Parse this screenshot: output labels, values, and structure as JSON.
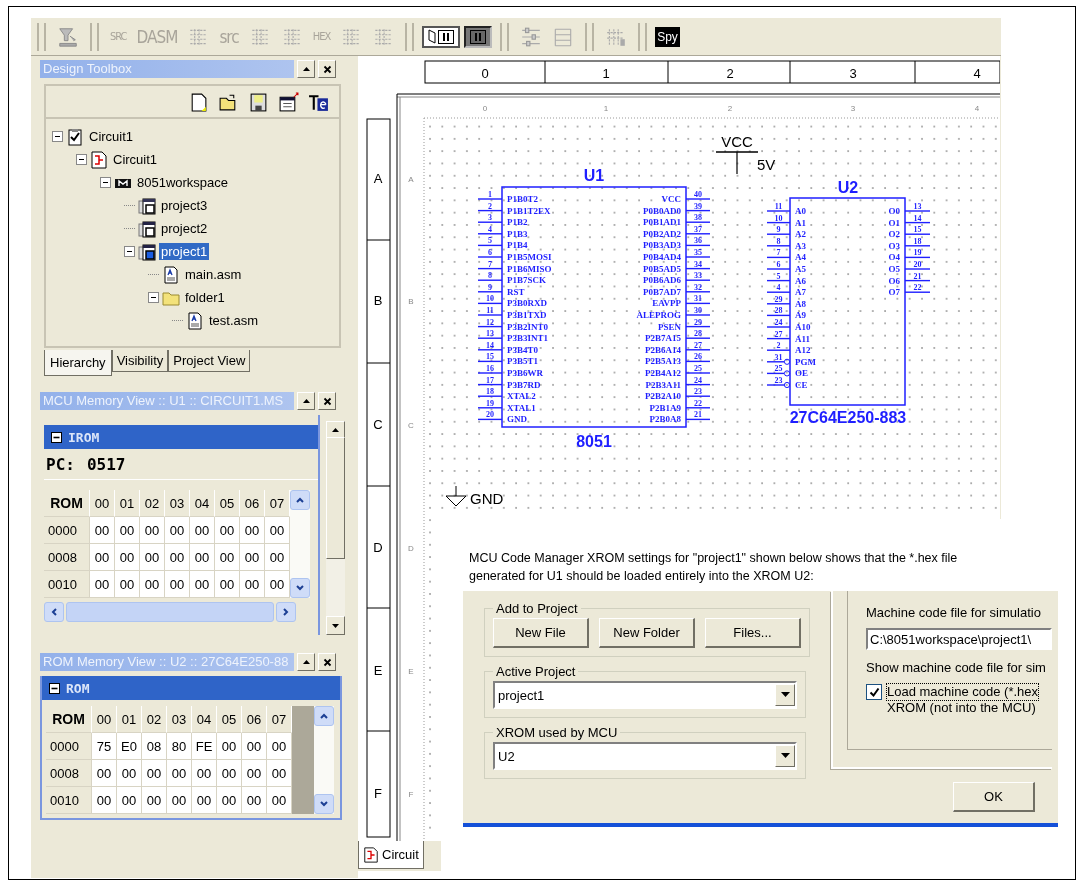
{
  "toolbar": {
    "groups": [
      [
        {
          "kind": "funnel"
        }
      ],
      [
        {
          "kind": "label",
          "text": "SRC"
        },
        {
          "kind": "label",
          "text": "DASM"
        },
        {
          "kind": "grid"
        },
        {
          "kind": "label",
          "text": "src"
        },
        {
          "kind": "grid"
        },
        {
          "kind": "grid"
        },
        {
          "kind": "label",
          "text": "HEX"
        },
        {
          "kind": "grid"
        },
        {
          "kind": "grid"
        }
      ],
      [
        {
          "kind": "page-pause"
        },
        {
          "kind": "pause"
        }
      ],
      [
        {
          "kind": "sliders"
        },
        {
          "kind": "lines"
        }
      ],
      [
        {
          "kind": "pins"
        }
      ],
      [
        {
          "kind": "badge",
          "text": "Spy"
        }
      ]
    ]
  },
  "design_toolbox": {
    "title": "Design Toolbox",
    "tree": [
      {
        "label": "Circuit1",
        "kind": "check",
        "expanded": true,
        "selected": false,
        "children": [
          {
            "label": "Circuit1",
            "kind": "schematic",
            "expanded": true,
            "selected": false,
            "children": [
              {
                "label": "8051workspace",
                "kind": "chip",
                "expanded": true,
                "selected": false,
                "children": [
                  {
                    "label": "project3",
                    "kind": "hex-project",
                    "selected": false
                  },
                  {
                    "label": "project2",
                    "kind": "project",
                    "selected": false
                  },
                  {
                    "label": "project1",
                    "kind": "active-project",
                    "expanded": true,
                    "selected": true,
                    "children": [
                      {
                        "label": "main.asm",
                        "kind": "asm",
                        "selected": false
                      },
                      {
                        "label": "folder1",
                        "kind": "folder",
                        "expanded": true,
                        "selected": false,
                        "children": [
                          {
                            "label": "test.asm",
                            "kind": "asm",
                            "selected": false
                          }
                        ]
                      }
                    ]
                  }
                ]
              }
            ]
          }
        ]
      }
    ],
    "tabs": [
      {
        "label": "Hierarchy",
        "selected": true
      },
      {
        "label": "Visibility",
        "selected": false
      },
      {
        "label": "Project View",
        "selected": false
      }
    ]
  },
  "mcu_memory": {
    "title": "MCU Memory View :: U1 :: CIRCUIT1.MS",
    "section": "IROM",
    "pc_label": "PC:",
    "pc_value": "0517",
    "columns": [
      "ROM",
      "00",
      "01",
      "02",
      "03",
      "04",
      "05",
      "06",
      "07"
    ],
    "rows": [
      [
        "0000",
        "00",
        "00",
        "00",
        "00",
        "00",
        "00",
        "00",
        "00"
      ],
      [
        "0008",
        "00",
        "00",
        "00",
        "00",
        "00",
        "00",
        "00",
        "00"
      ],
      [
        "0010",
        "00",
        "00",
        "00",
        "00",
        "00",
        "00",
        "00",
        "00"
      ]
    ]
  },
  "rom_memory": {
    "title": "ROM Memory View :: U2 :: 27C64E250-88",
    "section": "ROM",
    "columns": [
      "ROM",
      "00",
      "01",
      "02",
      "03",
      "04",
      "05",
      "06",
      "07"
    ],
    "rows": [
      [
        "0000",
        "75",
        "E0",
        "08",
        "80",
        "FE",
        "00",
        "00",
        "00"
      ],
      [
        "0008",
        "00",
        "00",
        "00",
        "00",
        "00",
        "00",
        "00",
        "00"
      ],
      [
        "0010",
        "00",
        "00",
        "00",
        "00",
        "00",
        "00",
        "00",
        "00"
      ]
    ]
  },
  "schematic": {
    "ruler_columns": [
      "0",
      "1",
      "2",
      "3",
      "4"
    ],
    "ruler_rows": [
      "A",
      "B",
      "C",
      "D",
      "E",
      "F"
    ],
    "inner_columns": [
      "0",
      "1",
      "2",
      "3",
      "4"
    ],
    "inner_rows": [
      "A",
      "B",
      "C",
      "D",
      "E",
      "F"
    ],
    "power": {
      "net": "VCC",
      "voltage": "5V"
    },
    "ground": {
      "net": "GND"
    },
    "u1": {
      "ref": "U1",
      "type": "8051",
      "left_pins": [
        {
          "num": "1",
          "name": "P1B0T2"
        },
        {
          "num": "2",
          "name": "P1B1T2EX"
        },
        {
          "num": "3",
          "name": "P1B2"
        },
        {
          "num": "4",
          "name": "P1B3"
        },
        {
          "num": "5",
          "name": "P1B4"
        },
        {
          "num": "6",
          "name": "P1B5MOSI"
        },
        {
          "num": "7",
          "name": "P1B6MISO"
        },
        {
          "num": "8",
          "name": "P1B7SCK"
        },
        {
          "num": "9",
          "name": "RST"
        },
        {
          "num": "10",
          "name": "P3B0RXD"
        },
        {
          "num": "11",
          "name": "P3B1TXD"
        },
        {
          "num": "12",
          "name": "P3B2INT0"
        },
        {
          "num": "13",
          "name": "P3B3INT1"
        },
        {
          "num": "14",
          "name": "P3B4T0"
        },
        {
          "num": "15",
          "name": "P3B5T1"
        },
        {
          "num": "16",
          "name": "P3B6WR"
        },
        {
          "num": "17",
          "name": "P3B7RD"
        },
        {
          "num": "18",
          "name": "XTAL2"
        },
        {
          "num": "19",
          "name": "XTAL1"
        },
        {
          "num": "20",
          "name": "GND"
        }
      ],
      "right_pins": [
        {
          "num": "40",
          "name": "VCC"
        },
        {
          "num": "39",
          "name": "P0B0AD0"
        },
        {
          "num": "38",
          "name": "P0B1AD1"
        },
        {
          "num": "37",
          "name": "P0B2AD2"
        },
        {
          "num": "36",
          "name": "P0B3AD3"
        },
        {
          "num": "35",
          "name": "P0B4AD4"
        },
        {
          "num": "34",
          "name": "P0B5AD5"
        },
        {
          "num": "33",
          "name": "P0B6AD6"
        },
        {
          "num": "32",
          "name": "P0B7AD7"
        },
        {
          "num": "31",
          "name": "EAVPP"
        },
        {
          "num": "30",
          "name": "ALEPROG"
        },
        {
          "num": "29",
          "name": "PSEN"
        },
        {
          "num": "28",
          "name": "P2B7A15"
        },
        {
          "num": "27",
          "name": "P2B6A14"
        },
        {
          "num": "26",
          "name": "P2B5A13"
        },
        {
          "num": "25",
          "name": "P2B4A12"
        },
        {
          "num": "24",
          "name": "P2B3A11"
        },
        {
          "num": "23",
          "name": "P2B2A10"
        },
        {
          "num": "22",
          "name": "P2B1A9"
        },
        {
          "num": "21",
          "name": "P2B0A8"
        }
      ]
    },
    "u2": {
      "ref": "U2",
      "type": "27C64E250-883",
      "left_pins": [
        {
          "num": "11",
          "name": "A0",
          "inverted": false
        },
        {
          "num": "10",
          "name": "A1",
          "inverted": false
        },
        {
          "num": "9",
          "name": "A2",
          "inverted": false
        },
        {
          "num": "8",
          "name": "A3",
          "inverted": false
        },
        {
          "num": "7",
          "name": "A4",
          "inverted": false
        },
        {
          "num": "6",
          "name": "A5",
          "inverted": false
        },
        {
          "num": "5",
          "name": "A6",
          "inverted": false
        },
        {
          "num": "4",
          "name": "A7",
          "inverted": false
        },
        {
          "num": "29",
          "name": "A8",
          "inverted": false
        },
        {
          "num": "28",
          "name": "A9",
          "inverted": false
        },
        {
          "num": "24",
          "name": "A10",
          "inverted": false
        },
        {
          "num": "27",
          "name": "A11",
          "inverted": false
        },
        {
          "num": "2",
          "name": "A12",
          "inverted": false
        },
        {
          "num": "31",
          "name": "PGM",
          "inverted": true
        },
        {
          "num": "25",
          "name": "OE",
          "inverted": true
        },
        {
          "num": "23",
          "name": "CE",
          "inverted": true
        }
      ],
      "right_pins": [
        {
          "num": "13",
          "name": "O0"
        },
        {
          "num": "14",
          "name": "O1"
        },
        {
          "num": "15",
          "name": "O2"
        },
        {
          "num": "18",
          "name": "O3"
        },
        {
          "num": "19",
          "name": "O4"
        },
        {
          "num": "20",
          "name": "O5"
        },
        {
          "num": "21",
          "name": "O6"
        },
        {
          "num": "22",
          "name": "O7"
        }
      ]
    }
  },
  "document_tab": {
    "label": "Circuit"
  },
  "note": "MCU Code Manager XROM settings for \"project1\" shown below shows that the *.hex file generated for U1 should be loaded entirely into the XROM U2:",
  "dialog": {
    "add_group": {
      "title": "Add to Project",
      "buttons": [
        "New File",
        "New Folder",
        "Files..."
      ]
    },
    "active_project": {
      "title": "Active Project",
      "value": "project1"
    },
    "xrom": {
      "title": "XROM used by MCU",
      "value": "U2"
    },
    "file_label": "Machine code file for simulatio",
    "file_value": "C:\\8051workspace\\project1\\",
    "show_label": "Show machine code file for sim",
    "load_checkbox": {
      "checked": true,
      "lines": [
        "Load machine code (*.hex",
        "XROM (not into the MCU)"
      ]
    },
    "ok": "OK"
  }
}
